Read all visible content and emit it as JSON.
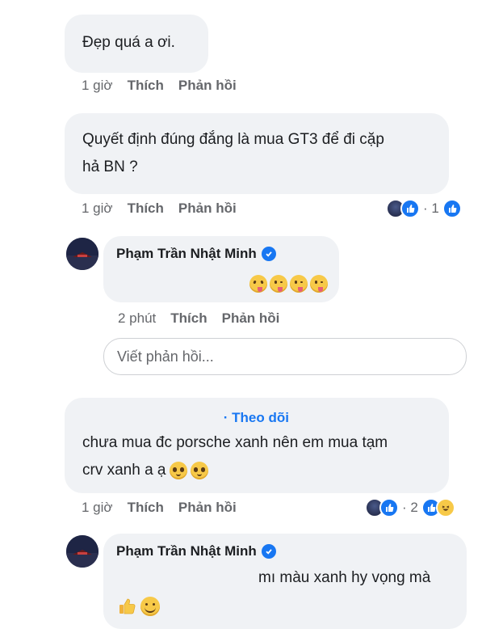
{
  "comments": [
    {
      "text": "Đẹp quá a ơi.",
      "time": "1 giờ",
      "like_label": "Thích",
      "reply_label": "Phản hồi"
    },
    {
      "text_line1": "Quyết định đúng đắng là mua GT3 để đi cặp",
      "text_line2": "hả BN ?",
      "time": "1 giờ",
      "like_label": "Thích",
      "reply_label": "Phản hồi",
      "reaction_count": "· 1"
    },
    {
      "author": "Phạm Trần Nhật Minh",
      "emojis": [
        "squinting-tongue-emoji",
        "winking-tongue-emoji",
        "winking-tongue-emoji",
        "winking-tongue-emoji"
      ],
      "time": "2 phút",
      "like_label": "Thích",
      "reply_label": "Phản hồi"
    },
    {
      "follow_label": "· Theo dõi",
      "text_line1": "chưa mua đc porsche xanh nên em mua tạm",
      "text_line2": "crv xanh a ạ",
      "emojis": [
        "pleading-face-emoji",
        "pleading-face-emoji"
      ],
      "time": "1 giờ",
      "like_label": "Thích",
      "reply_label": "Phản hồi",
      "reaction_count": "· 2"
    },
    {
      "author": "Phạm Trần Nhật Minh",
      "text": "mı màu xanh hy vọng mà",
      "emojis": [
        "thumbs-up-emoji",
        "smiling-face-emoji"
      ]
    }
  ],
  "reply_input": {
    "placeholder": "Viết phản hồi..."
  },
  "colors": {
    "bubble": "#f0f2f5",
    "accent": "#1877f2",
    "meta": "#65676b"
  }
}
